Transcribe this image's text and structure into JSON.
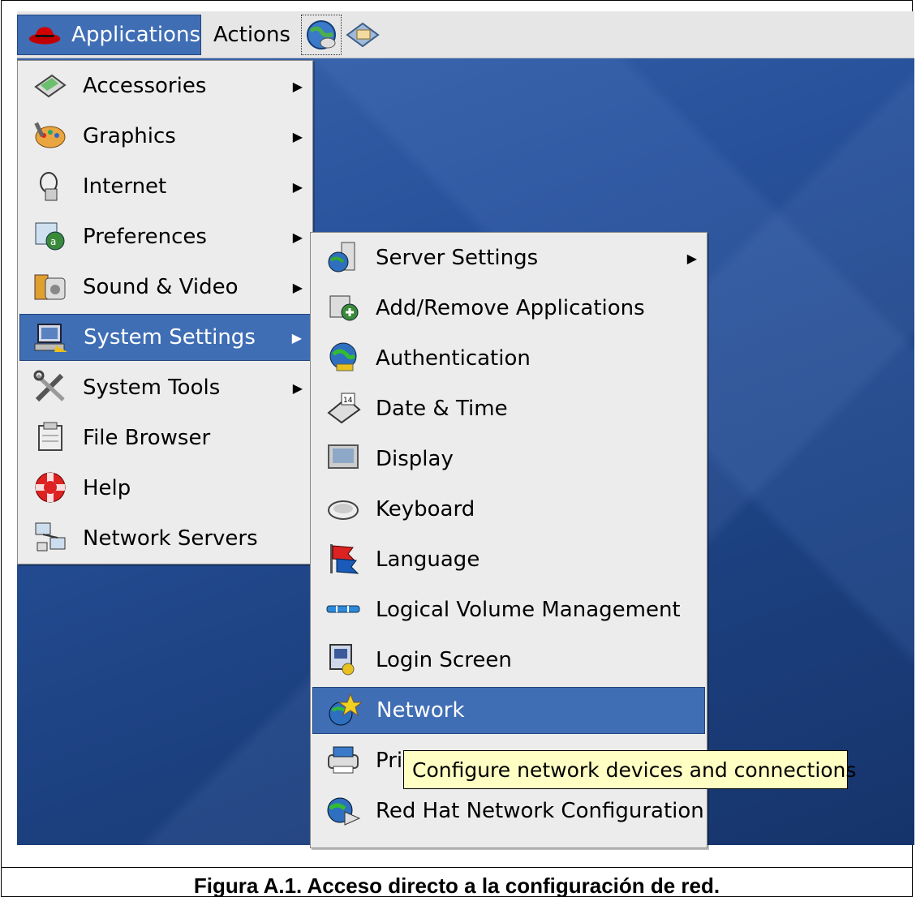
{
  "panel": {
    "applications_label": "Applications",
    "actions_label": "Actions"
  },
  "main_menu": {
    "items": [
      {
        "label": "Accessories",
        "icon": "accessories-icon",
        "submenu": true
      },
      {
        "label": "Graphics",
        "icon": "graphics-icon",
        "submenu": true
      },
      {
        "label": "Internet",
        "icon": "internet-icon",
        "submenu": true
      },
      {
        "label": "Preferences",
        "icon": "preferences-icon",
        "submenu": true
      },
      {
        "label": "Sound & Video",
        "icon": "sound-video-icon",
        "submenu": true
      },
      {
        "label": "System Settings",
        "icon": "system-settings-icon",
        "submenu": true,
        "selected": true
      },
      {
        "label": "System Tools",
        "icon": "system-tools-icon",
        "submenu": true
      },
      {
        "label": "File Browser",
        "icon": "file-browser-icon",
        "submenu": false
      },
      {
        "label": "Help",
        "icon": "help-icon",
        "submenu": false
      },
      {
        "label": "Network Servers",
        "icon": "network-servers-icon",
        "submenu": false
      }
    ]
  },
  "system_settings_menu": {
    "items": [
      {
        "label": "Server Settings",
        "icon": "server-settings-icon",
        "submenu": true
      },
      {
        "label": "Add/Remove Applications",
        "icon": "add-remove-icon",
        "submenu": false
      },
      {
        "label": "Authentication",
        "icon": "authentication-icon",
        "submenu": false
      },
      {
        "label": "Date & Time",
        "icon": "date-time-icon",
        "submenu": false
      },
      {
        "label": "Display",
        "icon": "display-icon",
        "submenu": false
      },
      {
        "label": "Keyboard",
        "icon": "keyboard-icon",
        "submenu": false
      },
      {
        "label": "Language",
        "icon": "language-icon",
        "submenu": false
      },
      {
        "label": "Logical Volume Management",
        "icon": "lvm-icon",
        "submenu": false
      },
      {
        "label": "Login Screen",
        "icon": "login-screen-icon",
        "submenu": false
      },
      {
        "label": "Network",
        "icon": "network-icon",
        "submenu": false,
        "selected": true
      },
      {
        "label": "Pri",
        "icon": "printing-icon",
        "submenu": false
      },
      {
        "label": "Red Hat Network Configuration",
        "icon": "rhn-config-icon",
        "submenu": false
      }
    ]
  },
  "tooltip": "Configure network devices and connections",
  "caption": "Figura A.1. Acceso directo a la configuración de red.",
  "colors": {
    "selection": "#3f6eb5",
    "tooltip_bg": "#ffffc4",
    "desktop": "#27519a"
  }
}
